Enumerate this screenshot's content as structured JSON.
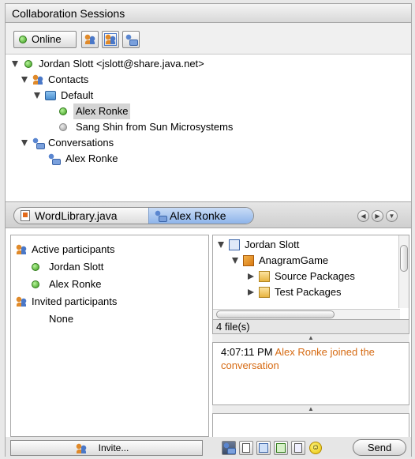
{
  "panel": {
    "title": "Collaboration Sessions"
  },
  "toolbar": {
    "online_label": "Online"
  },
  "session_tree": {
    "account": "Jordan Slott <jslott@share.java.net>",
    "contacts_label": "Contacts",
    "default_group": "Default",
    "contacts": [
      {
        "name": "Alex Ronke",
        "status": "online",
        "selected": true
      },
      {
        "name": "Sang Shin from Sun Microsystems",
        "status": "offline",
        "selected": false
      }
    ],
    "conversations_label": "Conversations",
    "conversations": [
      "Alex Ronke"
    ]
  },
  "tabs": [
    {
      "label": "WordLibrary.java",
      "active": false
    },
    {
      "label": "Alex Ronke",
      "active": true
    }
  ],
  "participants": {
    "active_label": "Active participants",
    "active": [
      "Jordan Slott",
      "Alex Ronke"
    ],
    "invited_label": "Invited participants",
    "invited": [
      "None"
    ]
  },
  "shared_files": {
    "owner": "Jordan Slott",
    "project": "AnagramGame",
    "folders": [
      "Source Packages",
      "Test Packages"
    ],
    "count_label": "4 file(s)"
  },
  "chat": {
    "messages": [
      {
        "time": "4:07:11 PM",
        "text": "Alex Ronke joined the conversation"
      }
    ]
  },
  "bottom": {
    "invite_label": "Invite...",
    "send_label": "Send"
  },
  "colors": {
    "selection": "#d4d4d4",
    "system_message": "#d66a12",
    "active_tab": "#a9c6f0",
    "online": "#3a9a1c"
  }
}
